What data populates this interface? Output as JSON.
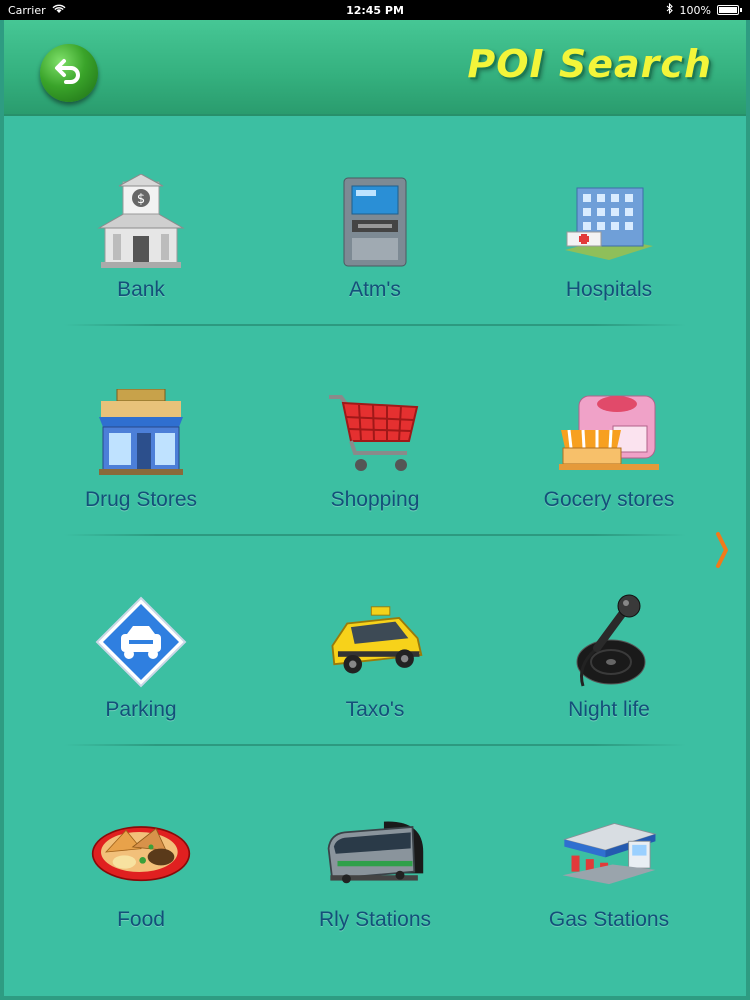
{
  "status_bar": {
    "carrier": "Carrier",
    "time": "12:45 PM",
    "battery": "100%"
  },
  "header": {
    "title": "POI Search"
  },
  "categories": [
    {
      "label": "Bank",
      "icon": "bank-icon"
    },
    {
      "label": "Atm's",
      "icon": "atm-icon"
    },
    {
      "label": "Hospitals",
      "icon": "hospital-icon"
    },
    {
      "label": "Drug Stores",
      "icon": "drug-store-icon"
    },
    {
      "label": "Shopping",
      "icon": "shopping-cart-icon"
    },
    {
      "label": "Gocery stores",
      "icon": "grocery-store-icon"
    },
    {
      "label": "Parking",
      "icon": "parking-icon"
    },
    {
      "label": "Taxo's",
      "icon": "taxi-icon"
    },
    {
      "label": "Night life",
      "icon": "microphone-icon"
    },
    {
      "label": "Food",
      "icon": "food-icon"
    },
    {
      "label": "Rly Stations",
      "icon": "train-icon"
    },
    {
      "label": "Gas Stations",
      "icon": "gas-station-icon"
    }
  ],
  "colors": {
    "background": "#3cbfa2",
    "header": "#34b07e",
    "title": "#f3f53a",
    "label": "#14507a",
    "arrow": "#f07a1a"
  }
}
